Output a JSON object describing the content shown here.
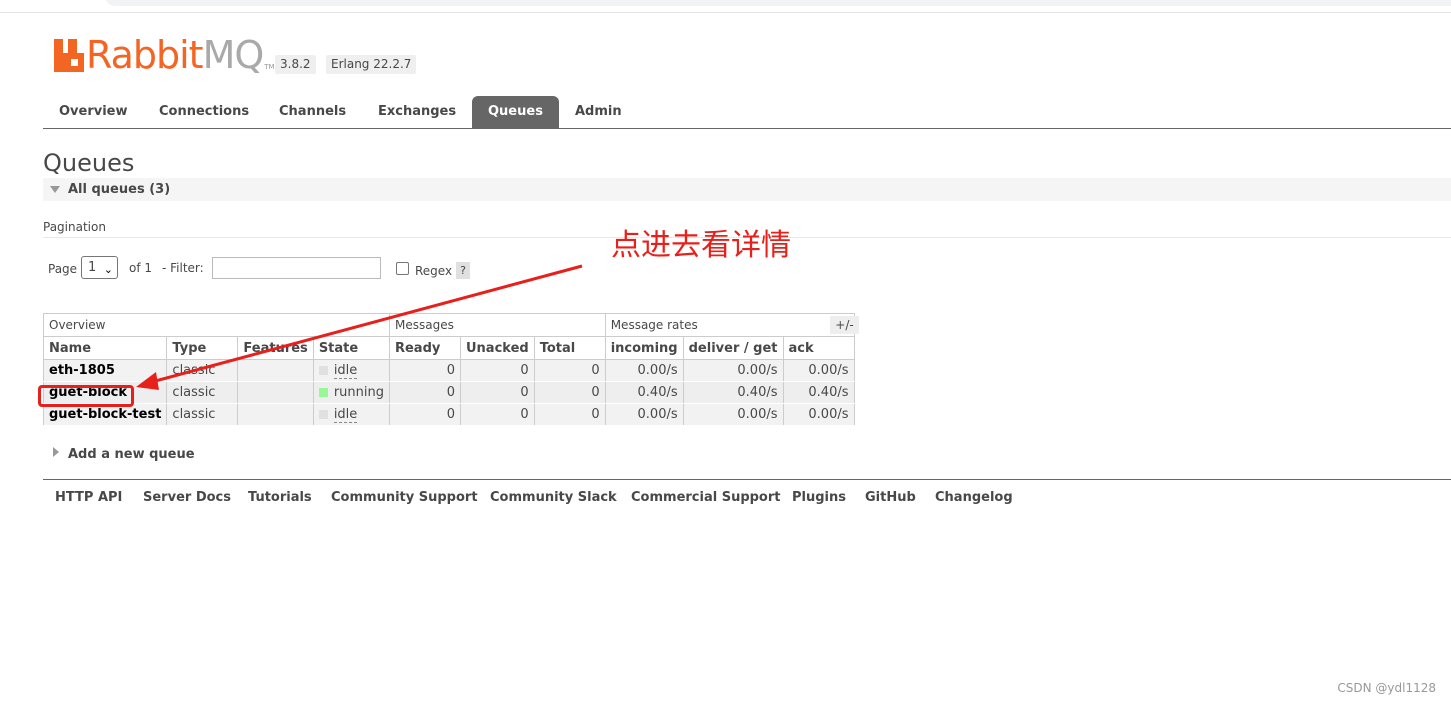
{
  "header": {
    "logo_rabbit": "Rabbit",
    "logo_mq": "MQ",
    "logo_tm": "TM",
    "version": "3.8.2",
    "erlang": "Erlang 22.2.7",
    "brand_color": "#f26522"
  },
  "tabs": [
    {
      "label": "Overview"
    },
    {
      "label": "Connections"
    },
    {
      "label": "Channels"
    },
    {
      "label": "Exchanges"
    },
    {
      "label": "Queues",
      "active": true
    },
    {
      "label": "Admin"
    }
  ],
  "page_title": "Queues",
  "section_title": "All queues (3)",
  "pagination": {
    "label": "Pagination",
    "page_label": "Page",
    "page_value": "1",
    "of_label": "of 1",
    "filter_label": "- Filter:",
    "filter_value": "",
    "regex_label": "Regex",
    "regex_checked": false,
    "help": "?"
  },
  "table": {
    "groups": [
      "Overview",
      "Messages",
      "Message rates"
    ],
    "columns": [
      "Name",
      "Type",
      "Features",
      "State",
      "Ready",
      "Unacked",
      "Total",
      "incoming",
      "deliver / get",
      "ack"
    ],
    "toggle": "+/-",
    "rows": [
      {
        "name": "eth-1805",
        "type": "classic",
        "features": "",
        "state": "idle",
        "ready": "0",
        "unacked": "0",
        "total": "0",
        "incoming": "0.00/s",
        "deliver": "0.00/s",
        "ack": "0.00/s"
      },
      {
        "name": "guet-block",
        "type": "classic",
        "features": "",
        "state": "running",
        "ready": "0",
        "unacked": "0",
        "total": "0",
        "incoming": "0.40/s",
        "deliver": "0.40/s",
        "ack": "0.40/s"
      },
      {
        "name": "guet-block-test",
        "type": "classic",
        "features": "",
        "state": "idle",
        "ready": "0",
        "unacked": "0",
        "total": "0",
        "incoming": "0.00/s",
        "deliver": "0.00/s",
        "ack": "0.00/s"
      }
    ],
    "state_colors": {
      "idle": "#dddddd",
      "running": "#98f898"
    }
  },
  "add_queue": "Add a new queue",
  "footer_links": [
    "HTTP API",
    "Server Docs",
    "Tutorials",
    "Community Support",
    "Community Slack",
    "Commercial Support",
    "Plugins",
    "GitHub",
    "Changelog"
  ],
  "annotation": {
    "text": "点进去看详情",
    "color": "#e8201b"
  },
  "watermark": "CSDN @ydl1128"
}
